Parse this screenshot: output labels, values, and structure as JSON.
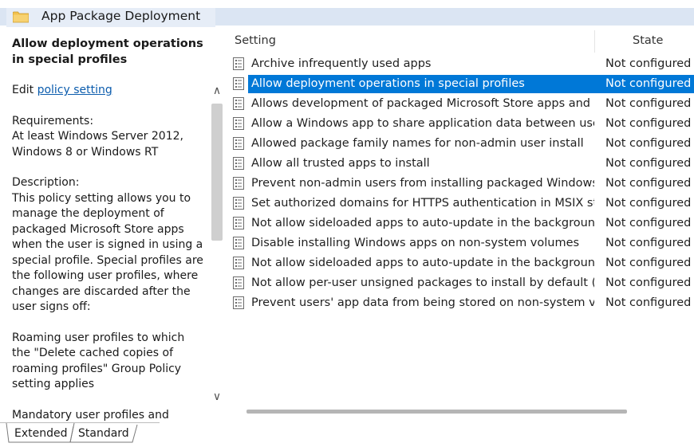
{
  "window": {
    "title": "App Package Deployment",
    "icon": "folder-icon"
  },
  "description": {
    "heading": "Allow deployment operations in special profiles",
    "edit_prefix": "Edit ",
    "edit_link": "policy setting",
    "requirements_label": "Requirements:",
    "requirements_text": "At least Windows Server 2012, Windows 8 or Windows RT",
    "description_label": "Description:",
    "description_text": "This policy setting allows you to manage the deployment of packaged Microsoft Store apps when the user is signed in using a special profile. Special profiles are the following user profiles, where changes are discarded after the user signs off:",
    "roaming_text": "Roaming user profiles to which the \"Delete cached copies of roaming profiles\" Group Policy setting applies",
    "cutoff_text": "Mandatory user profiles and super-"
  },
  "list": {
    "columns": {
      "setting": "Setting",
      "state": "State"
    },
    "rows": [
      {
        "name": "Archive infrequently used apps",
        "state": "Not configured"
      },
      {
        "name": "Allow deployment operations in special profiles",
        "state": "Not configured",
        "selected": true
      },
      {
        "name": "Allows development of packaged Microsoft Store apps and i...",
        "state": "Not configured"
      },
      {
        "name": "Allow a Windows app to share application data between users",
        "state": "Not configured"
      },
      {
        "name": "Allowed package family names for non-admin user install",
        "state": "Not configured"
      },
      {
        "name": "Allow all trusted apps to install",
        "state": "Not configured"
      },
      {
        "name": "Prevent non-admin users from installing packaged Windows ...",
        "state": "Not configured"
      },
      {
        "name": "Set authorized domains for HTTPS authentication in MSIX str...",
        "state": "Not configured"
      },
      {
        "name": "Not allow sideloaded apps to auto-update in the background",
        "state": "Not configured"
      },
      {
        "name": "Disable installing Windows apps on non-system volumes",
        "state": "Not configured"
      },
      {
        "name": "Not allow sideloaded apps to auto-update in the backgroun...",
        "state": "Not configured"
      },
      {
        "name": "Not allow per-user unsigned packages to install by default (r...",
        "state": "Not configured"
      },
      {
        "name": "Prevent users' app data from being stored on non-system vo...",
        "state": "Not configured"
      }
    ]
  },
  "tabs": [
    "Extended",
    "Standard"
  ],
  "colors": {
    "selection": "#0078d7",
    "link": "#0b5cad",
    "band": "#dbe5f3"
  }
}
